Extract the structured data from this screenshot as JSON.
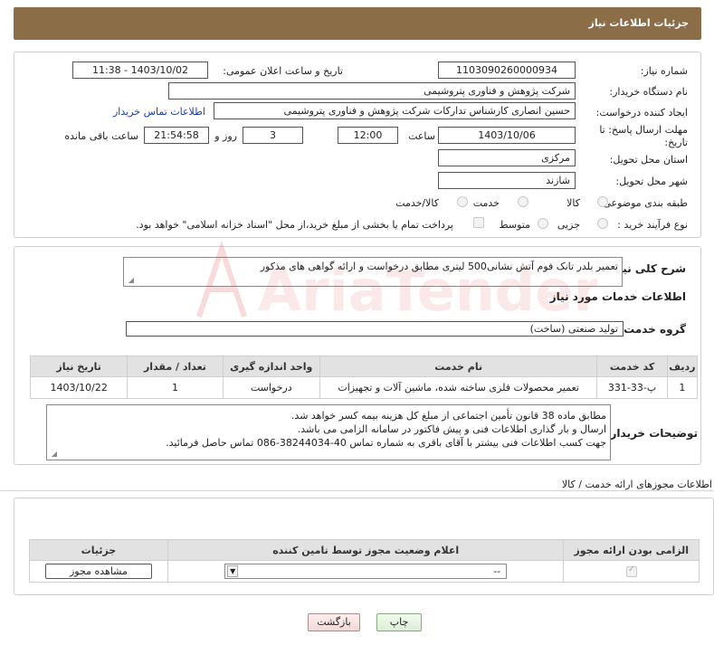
{
  "header": {
    "title": "جزئیات اطلاعات نیاز"
  },
  "form": {
    "need_number_label": "شماره نیاز:",
    "need_number": "1103090260000934",
    "announce_label": "تاریخ و ساعت اعلان عمومی:",
    "announce_value": "1403/10/02 - 11:38",
    "buyer_org_label": "نام دستگاه خریدار:",
    "buyer_org": "شرکت پژوهش و فناوری پتروشیمی",
    "creator_label": "ایجاد کننده درخواست:",
    "creator": "حسین انصاری کارشناس تدارکات شرکت پژوهش و فناوری پتروشیمی",
    "contact_link": "اطلاعات تماس خریدار",
    "deadline_label_1": "مهلت ارسال پاسخ: تا",
    "deadline_label_2": "تاریخ:",
    "deadline_date": "1403/10/06",
    "time_label": "ساعت",
    "deadline_time": "12:00",
    "days_value": "3",
    "days_label": "روز و",
    "remaining_value": "21:54:58",
    "remaining_label": "ساعت باقی مانده",
    "province_label": "استان محل تحویل:",
    "province": "مرکزی",
    "city_label": "شهر محل تحویل:",
    "city": "شازند",
    "category_label": "طبقه بندی موضوعی:",
    "category_options": [
      "کالا",
      "خدمت",
      "کالا/خدمت"
    ],
    "process_label": "نوع فرآیند خرید :",
    "process_options": [
      "جزیی",
      "متوسط"
    ],
    "payment_text": "پرداخت تمام یا بخشی از مبلغ خرید،از محل \"اسناد خزانه اسلامی\" خواهد بود."
  },
  "summary": {
    "label": "شرح کلی نیاز:",
    "text": "تعمیر بلدر تانک فوم آتش نشانی500 لیتری مطابق درخواست و ارائه گواهی های مذکور"
  },
  "services": {
    "section_title": "اطلاعات خدمات مورد نیاز",
    "group_label": "گروه خدمت:",
    "group_value": "تولید صنعتی (ساخت)",
    "columns": [
      "ردیف",
      "کد خدمت",
      "نام خدمت",
      "واحد اندازه گیری",
      "تعداد / مقدار",
      "تاریخ نیاز"
    ],
    "rows": [
      [
        "1",
        "پ-33-331",
        "تعمیر محصولات فلزی ساخته شده، ماشین آلات و تجهیزات",
        "درخواست",
        "1",
        "1403/10/22"
      ]
    ]
  },
  "notes": {
    "label": "توضیحات خریدار:",
    "lines": [
      "مطابق ماده 38 قانون تأمین اجتماعی از مبلغ کل هزینه بیمه کسر خواهد شد.",
      "ارسال و بار گذاری اطلاعات فنی و پیش فاکتور در سامانه الزامی می باشد.",
      "جهت کسب اطلاعات فنی بیشتر با آقای باقری به شماره تماس  40-38244034-086 تماس حاصل فرمائید."
    ]
  },
  "permits": {
    "section_title": "اطلاعات مجوزهای ارائه خدمت / کالا",
    "columns": [
      "الزامی بودن ارائه مجوز",
      "اعلام وضعیت مجوز توسط تامین کننده",
      "جزئیات"
    ],
    "select_value": "--",
    "view_button": "مشاهده مجوز"
  },
  "buttons": {
    "print": "چاپ",
    "back": "بازگشت"
  },
  "watermark": {
    "text": "AriaTender.neT",
    "color": "#d94040"
  }
}
